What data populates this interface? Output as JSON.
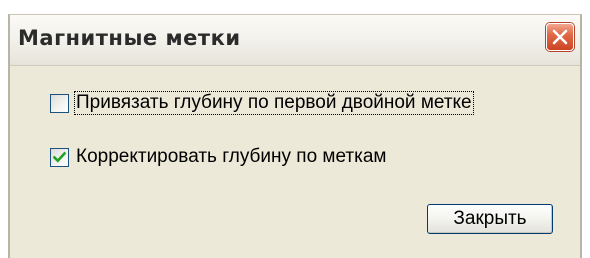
{
  "window": {
    "title": "Магнитные метки",
    "close_icon": "close-x-icon"
  },
  "options": [
    {
      "label": "Привязать глубину по первой двойной метке",
      "checked": false,
      "focused": true
    },
    {
      "label": "Корректировать глубину по меткам",
      "checked": true,
      "focused": false
    }
  ],
  "buttons": {
    "close_label": "Закрыть"
  },
  "colors": {
    "dialog_background": "#ece9d8",
    "close_button_red": "#e06a48",
    "checkmark_green": "#21a121",
    "checkbox_border": "#1c5180"
  }
}
